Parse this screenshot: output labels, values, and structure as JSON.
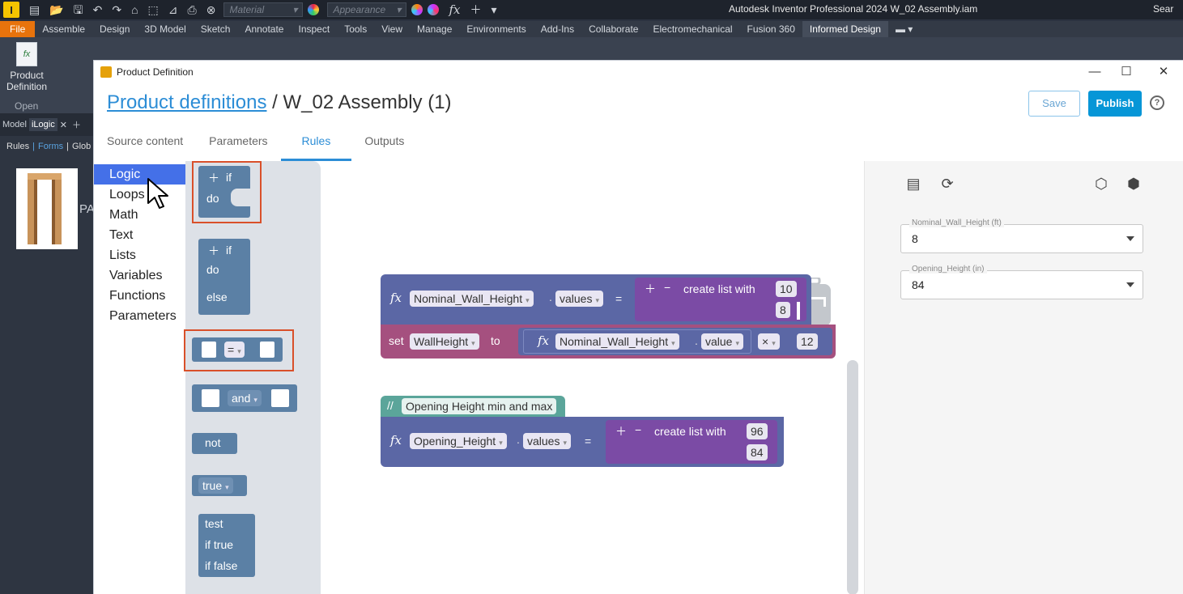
{
  "titlebar": {
    "material_placeholder": "Material",
    "appearance_placeholder": "Appearance",
    "window_title": "Autodesk Inventor Professional 2024   W_02 Assembly.iam",
    "search_label": "Sear"
  },
  "ribbon_tabs": [
    "File",
    "Assemble",
    "Design",
    "3D Model",
    "Sketch",
    "Annotate",
    "Inspect",
    "Tools",
    "View",
    "Manage",
    "Environments",
    "Add-Ins",
    "Collaborate",
    "Electromechanical",
    "Fusion 360",
    "Informed Design"
  ],
  "ribbon": {
    "product_definition_label": "Product Definition",
    "panel_label": "Open"
  },
  "browser": {
    "tabs": [
      "Model",
      "iLogic"
    ],
    "sub": [
      "Rules",
      "Forms",
      "Glob"
    ],
    "thumb_label": "PA"
  },
  "dialog": {
    "title": "Product Definition",
    "crumb_link": "Product definitions",
    "crumb_sep": " / ",
    "crumb_current": "W_02 Assembly (1)",
    "save_label": "Save",
    "publish_label": "Publish",
    "tabs": [
      "Source content",
      "Parameters",
      "Rules",
      "Outputs"
    ],
    "active_tab": "Rules"
  },
  "categories": [
    "Logic",
    "Loops",
    "Math",
    "Text",
    "Lists",
    "Variables",
    "Functions",
    "Parameters"
  ],
  "flyout": {
    "if_label": "if",
    "do_label": "do",
    "else_label": "else",
    "eq_label": "=",
    "and_label": "and",
    "not_label": "not",
    "true_label": "true",
    "test_label": "test",
    "iftrue_label": "if true",
    "iffalse_label": "if false"
  },
  "workspace": {
    "block1": {
      "param": "Nominal_Wall_Height",
      "prop": "values",
      "op": "=",
      "list_label": "create list with",
      "items": [
        "10",
        "8"
      ]
    },
    "block2": {
      "set_label": "set",
      "var": "WallHeight",
      "to_label": "to",
      "param": "Nominal_Wall_Height",
      "prop": "value",
      "op": "×",
      "num": "12"
    },
    "comment": "Opening Height min and max",
    "comment_marker": "//",
    "block3": {
      "param": "Opening_Height",
      "prop": "values",
      "op": "=",
      "list_label": "create list with",
      "items": [
        "96",
        "84"
      ]
    }
  },
  "right_panel": {
    "fields": [
      {
        "label": "Nominal_Wall_Height (ft)",
        "value": "8"
      },
      {
        "label": "Opening_Height (in)",
        "value": "84"
      }
    ]
  },
  "colors": {
    "accent": "#0696d7",
    "param_block": "#5b67a5",
    "list_block": "#7b4ba5",
    "set_block": "#a5507f",
    "logic_block": "#5b80a5",
    "comment_block": "#5ba59a",
    "highlight": "#d9502a"
  }
}
